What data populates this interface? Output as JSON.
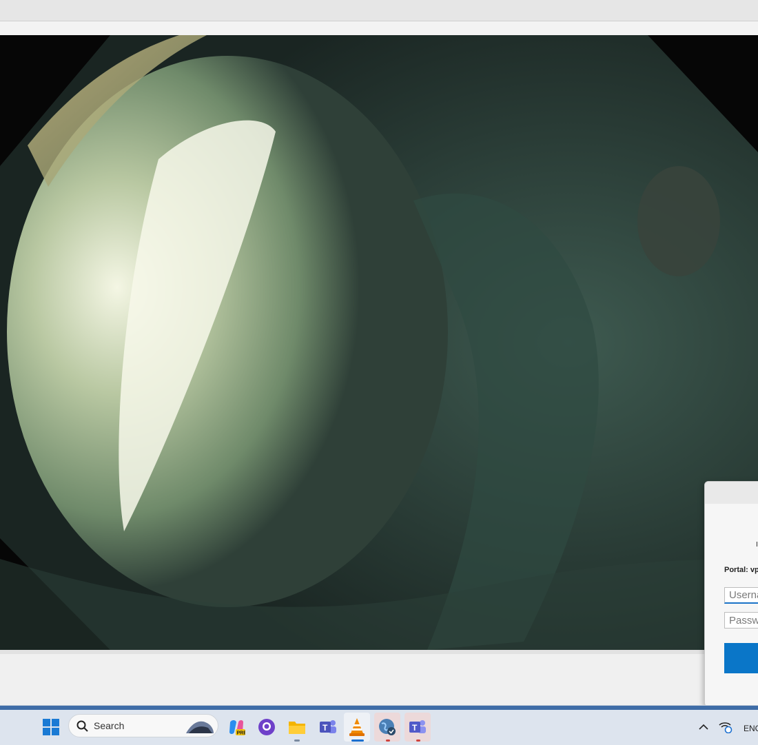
{
  "video": {
    "description_hidden": ""
  },
  "dialog": {
    "glyph": "I",
    "portal_label": "Portal: vp",
    "username_placeholder": "Username",
    "password_placeholder": "Password",
    "connect_label": ""
  },
  "taskbar": {
    "search_placeholder": "Search",
    "language": "ENG",
    "accent_color": "#3f6da7",
    "icons": [
      "windows-start-icon",
      "search-icon",
      "copilot-icon",
      "github-desktop-icon",
      "file-explorer-icon",
      "teams-icon",
      "vlc-icon",
      "vpn-globe-icon",
      "teams-new-icon",
      "chevron-up-icon",
      "network-sync-icon"
    ]
  },
  "colors": {
    "dialog_button": "#0a76c8",
    "input_focus": "#1a73c7"
  }
}
